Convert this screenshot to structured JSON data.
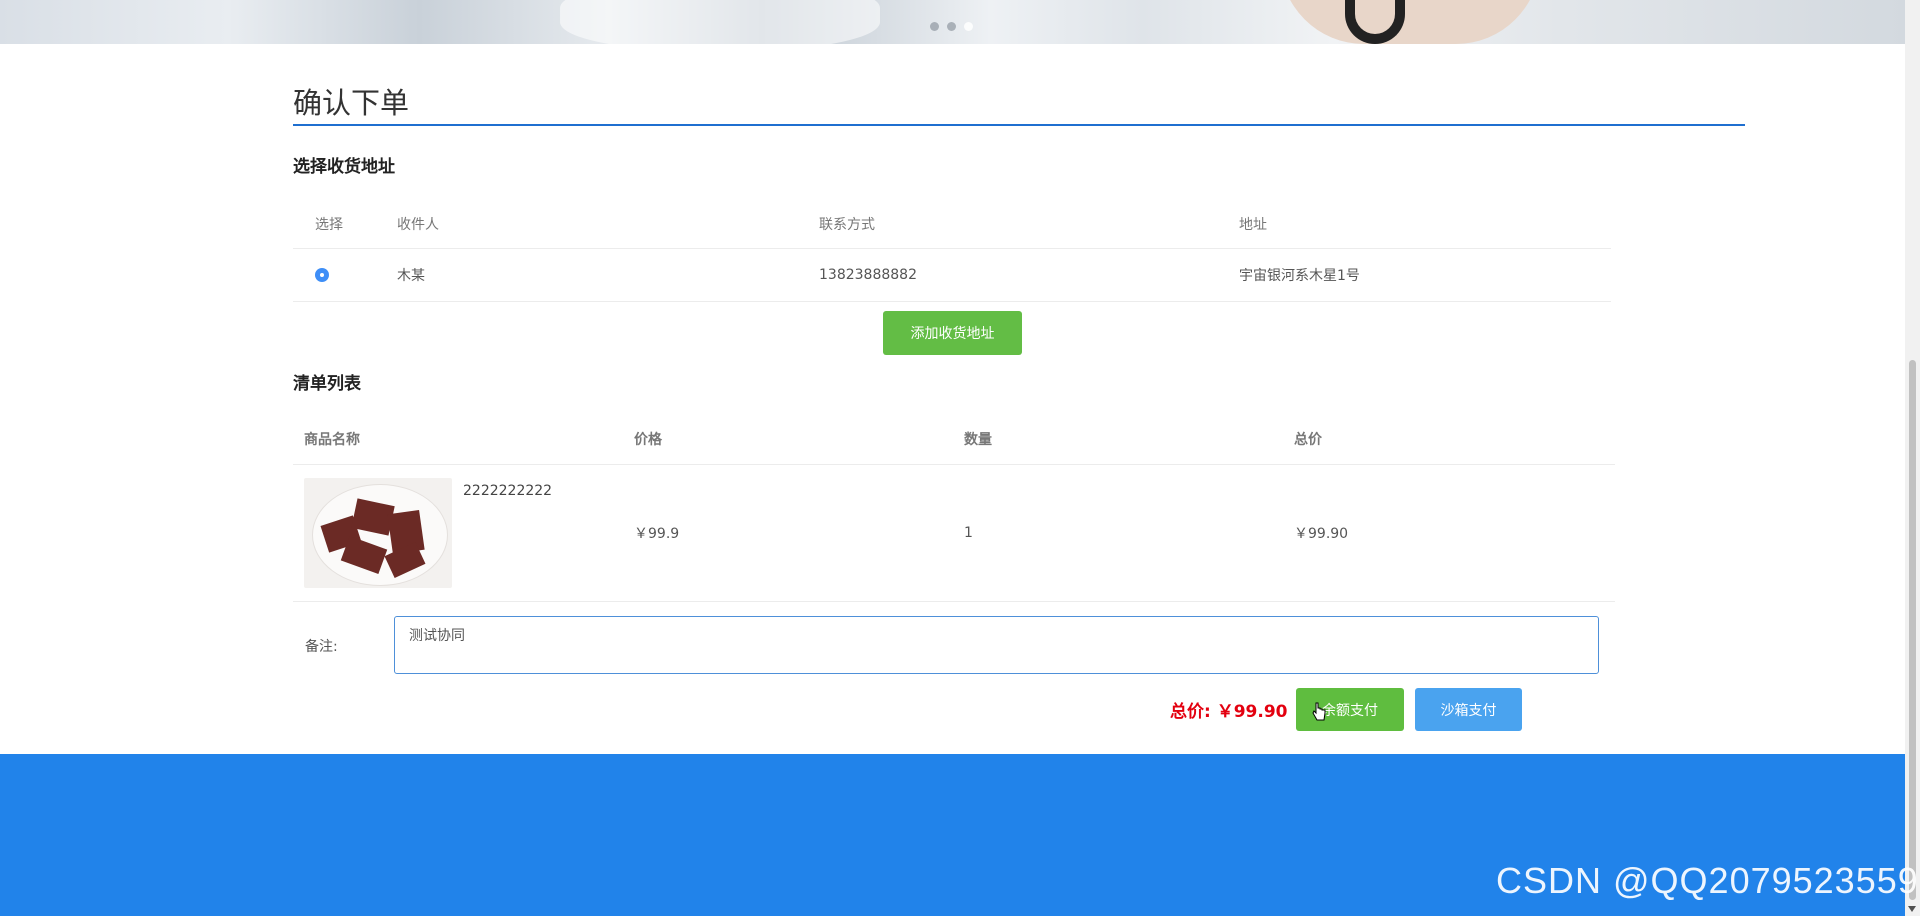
{
  "page": {
    "title": "确认下单"
  },
  "address_section": {
    "title": "选择收货地址",
    "headers": {
      "select": "选择",
      "receiver": "收件人",
      "contact": "联系方式",
      "address": "地址"
    },
    "rows": [
      {
        "selected": true,
        "receiver": "木某",
        "contact": "13823888882",
        "address": "宇宙银河系木星1号"
      }
    ],
    "add_button": "添加收货地址"
  },
  "goods_section": {
    "title": "清单列表",
    "headers": {
      "name": "商品名称",
      "price": "价格",
      "quantity": "数量",
      "total": "总价"
    },
    "rows": [
      {
        "name": "2222222222",
        "price": "￥99.9",
        "quantity": "1",
        "total": "￥99.90"
      }
    ]
  },
  "remark": {
    "label": "备注:",
    "value": "测试协同"
  },
  "summary": {
    "total_label": "总价: ￥99.90",
    "balance_pay": "余额支付",
    "sandbox_pay": "沙箱支付"
  },
  "watermark": "CSDN @QQ2079523559",
  "colors": {
    "accent_blue": "#1f6fd0",
    "green": "#63bd45",
    "light_blue": "#4aa3ef",
    "price_red": "#e3000f",
    "footer": "#2183ea"
  }
}
